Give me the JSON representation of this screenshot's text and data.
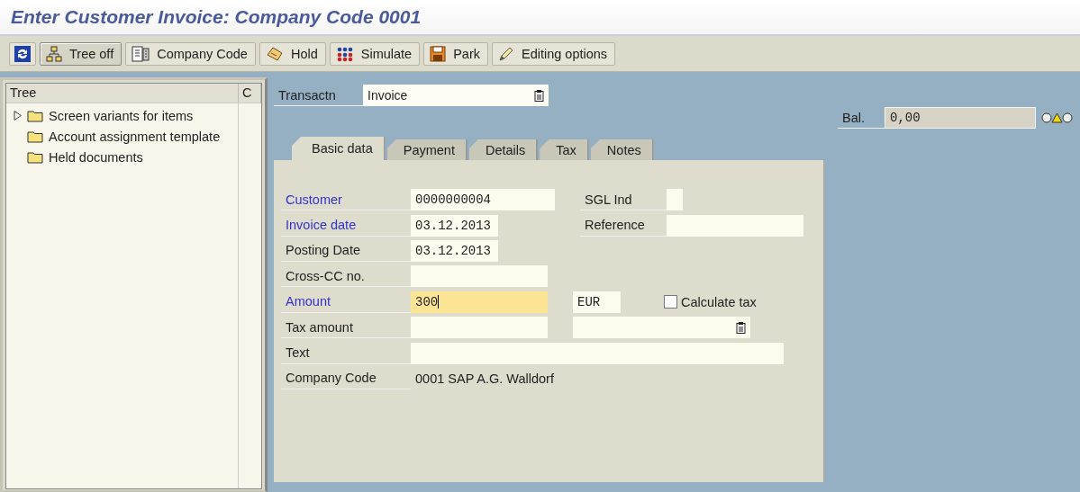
{
  "window": {
    "title": "Enter Customer Invoice: Company Code 0001"
  },
  "toolbar": [
    {
      "pressed": false
    },
    {
      "label": "Tree off",
      "pressed": true
    },
    {
      "label": "Company Code",
      "pressed": false
    },
    {
      "label": "Hold",
      "pressed": false
    },
    {
      "label": "Simulate",
      "pressed": false
    },
    {
      "label": "Park",
      "pressed": false
    },
    {
      "label": "Editing options",
      "pressed": false
    }
  ],
  "tree": {
    "columns": [
      "Tree",
      "C"
    ],
    "items": [
      {
        "label": "Screen variants for items",
        "expanded": false
      },
      {
        "label": "Account assignment template"
      },
      {
        "label": "Held documents"
      }
    ]
  },
  "transaction": {
    "label": "Transactn",
    "value": "Invoice"
  },
  "balance": {
    "label": "Bal.",
    "value": "0,00"
  },
  "tabs": [
    {
      "label": "Basic data",
      "selected": true
    },
    {
      "label": "Payment",
      "selected": false
    },
    {
      "label": "Details",
      "selected": false
    },
    {
      "label": "Tax",
      "selected": false
    },
    {
      "label": "Notes",
      "selected": false
    }
  ],
  "form": {
    "rows": [
      {
        "kind": "field",
        "label": "Customer",
        "required": true,
        "value": "0000000004",
        "focused": false,
        "side": {
          "kind": "labeled_field",
          "label": "SGL Ind"
        }
      },
      {
        "kind": "field",
        "label": "Invoice date",
        "required": true,
        "value": "03.12.2013",
        "focused": false,
        "side": {
          "kind": "labeled_field",
          "label": "Reference"
        }
      },
      {
        "kind": "field",
        "label": "Posting Date",
        "required": false,
        "value": "03.12.2013",
        "focused": false
      },
      {
        "kind": "field",
        "label": "Cross-CC no.",
        "required": false,
        "focused": false
      },
      {
        "kind": "field",
        "label": "Amount",
        "required": true,
        "value": "300",
        "focused": true,
        "side": {
          "kind": "currency",
          "value": "EUR",
          "checkbox": {
            "label": "Calculate tax",
            "checked": false
          }
        }
      },
      {
        "kind": "field",
        "label": "Tax amount",
        "required": false,
        "focused": false,
        "side": {
          "kind": "dropdown"
        }
      },
      {
        "kind": "field",
        "label": "Text",
        "required": false,
        "focused": false
      },
      {
        "kind": "display",
        "label": "Company Code",
        "required": false,
        "value": "0001 SAP A.G. Walldorf"
      }
    ]
  }
}
